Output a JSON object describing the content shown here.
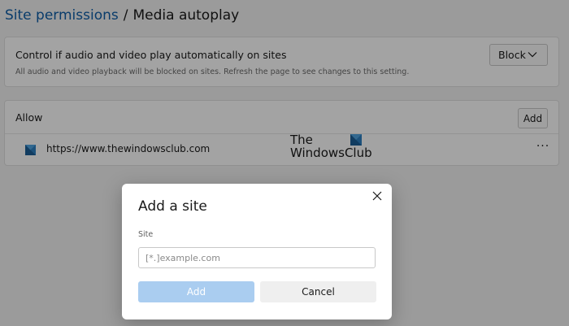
{
  "breadcrumb": {
    "parent": "Site permissions",
    "separator": "/",
    "current": "Media autoplay"
  },
  "autoplay": {
    "title": "Control if audio and video play automatically on sites",
    "description": "All audio and video playback will be blocked on sites. Refresh the page to see changes to this setting.",
    "selected_option": "Block"
  },
  "allow": {
    "title": "Allow",
    "add_label": "Add",
    "sites": [
      {
        "url": "https://www.thewindowsclub.com",
        "more_label": "···"
      }
    ]
  },
  "watermark": {
    "line1": "The",
    "line2": "WindowsClub"
  },
  "dialog": {
    "title": "Add a site",
    "field_label": "Site",
    "input_value": "",
    "input_placeholder": "[*.]example.com",
    "primary_label": "Add",
    "secondary_label": "Cancel"
  },
  "colors": {
    "link": "#0f5ea8",
    "primary_disabled": "#aacdf0",
    "overlay": "rgba(0,0,0,0.36)",
    "favicon": "#2d7fc1"
  }
}
